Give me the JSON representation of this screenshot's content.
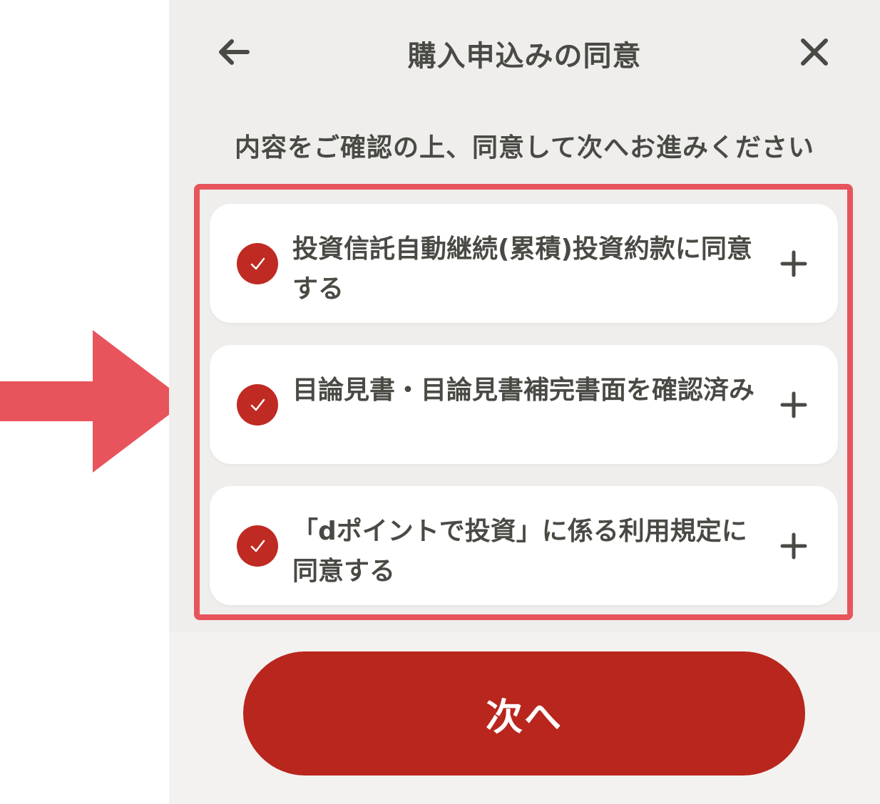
{
  "header": {
    "title": "購入申込みの同意",
    "back_icon": "arrow-left-icon",
    "close_icon": "close-icon"
  },
  "subtitle": "内容をご確認の上、同意して次へお進みください",
  "agreements": [
    {
      "label": "投資信託自動継続(累積)投資約款に同意する",
      "checked": true,
      "expand_icon": "plus-icon"
    },
    {
      "label": "目論見書・目論見書補完書面を確認済み",
      "checked": true,
      "expand_icon": "plus-icon"
    },
    {
      "label": "「dポイントで投資」に係る利用規定に同意する",
      "checked": true,
      "expand_icon": "plus-icon"
    }
  ],
  "next_button": {
    "label": "次へ"
  },
  "colors": {
    "accent": "#b8261d",
    "check": "#bf2a23",
    "highlight": "#e8545c",
    "text": "#4a4a45",
    "background": "#efeeec"
  }
}
